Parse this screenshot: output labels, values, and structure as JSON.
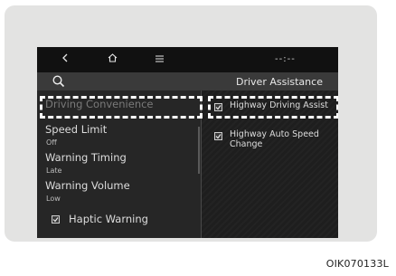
{
  "header": {
    "time": "--:--",
    "icons": [
      "back-icon",
      "home-icon",
      "menu-icon",
      "search-icon"
    ],
    "title": "Driver Assistance"
  },
  "left_menu": {
    "category": "Driving Convenience",
    "items": [
      {
        "label": "Speed Limit",
        "value": "Off"
      },
      {
        "label": "Warning Timing",
        "value": "Late"
      },
      {
        "label": "Warning Volume",
        "value": "Low"
      }
    ],
    "haptic": {
      "label": "Haptic Warning",
      "checked": true
    }
  },
  "right_menu": {
    "items": [
      {
        "label": "Highway Driving Assist",
        "checked": true
      },
      {
        "label": "Highway Auto Speed Change",
        "checked": true
      }
    ]
  },
  "caption": "OIK070133L",
  "colors": {
    "screen_bg": "#1c1c1c",
    "header_bg": "#3a3a3a",
    "highlight": "#ffffff",
    "frame": "#e3e3e2"
  }
}
